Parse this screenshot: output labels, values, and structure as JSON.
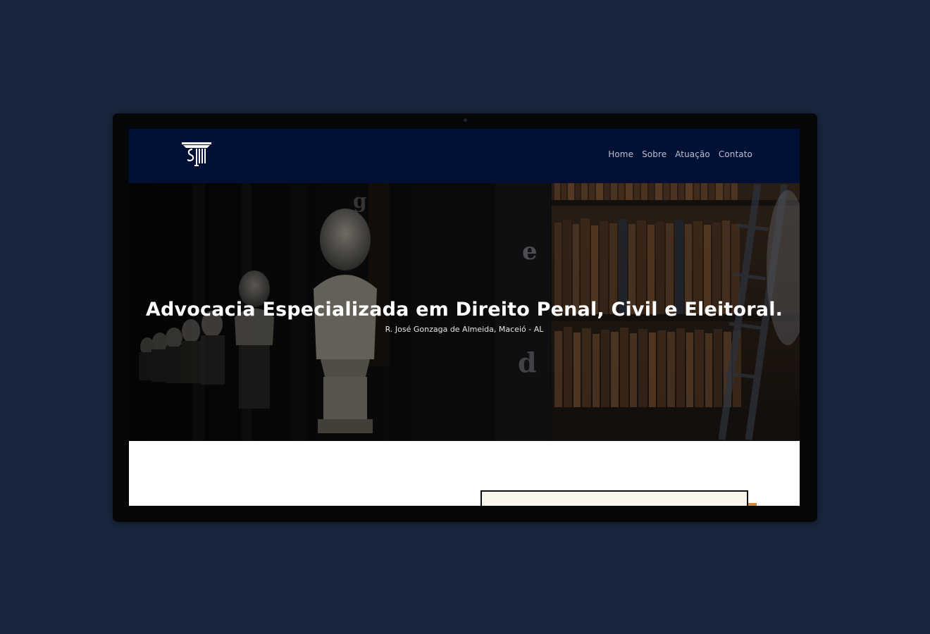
{
  "nav": {
    "logo_alt": "SM logo",
    "items": [
      {
        "label": "Home"
      },
      {
        "label": "Sobre"
      },
      {
        "label": "Atuação"
      },
      {
        "label": "Contato"
      }
    ]
  },
  "hero": {
    "title": "Advocacia Especializada em Direito Penal, Civil e Eleitoral.",
    "subtitle": "R. José Gonzaga de Almeida, Maceió - AL",
    "background_description": "library-with-busts",
    "shelf_letters": [
      "g",
      "e",
      "d"
    ]
  },
  "colors": {
    "page_background": "#18253c",
    "navbar": "#031035",
    "monitor_bezel": "#050607",
    "accent": "#c98a3a"
  }
}
